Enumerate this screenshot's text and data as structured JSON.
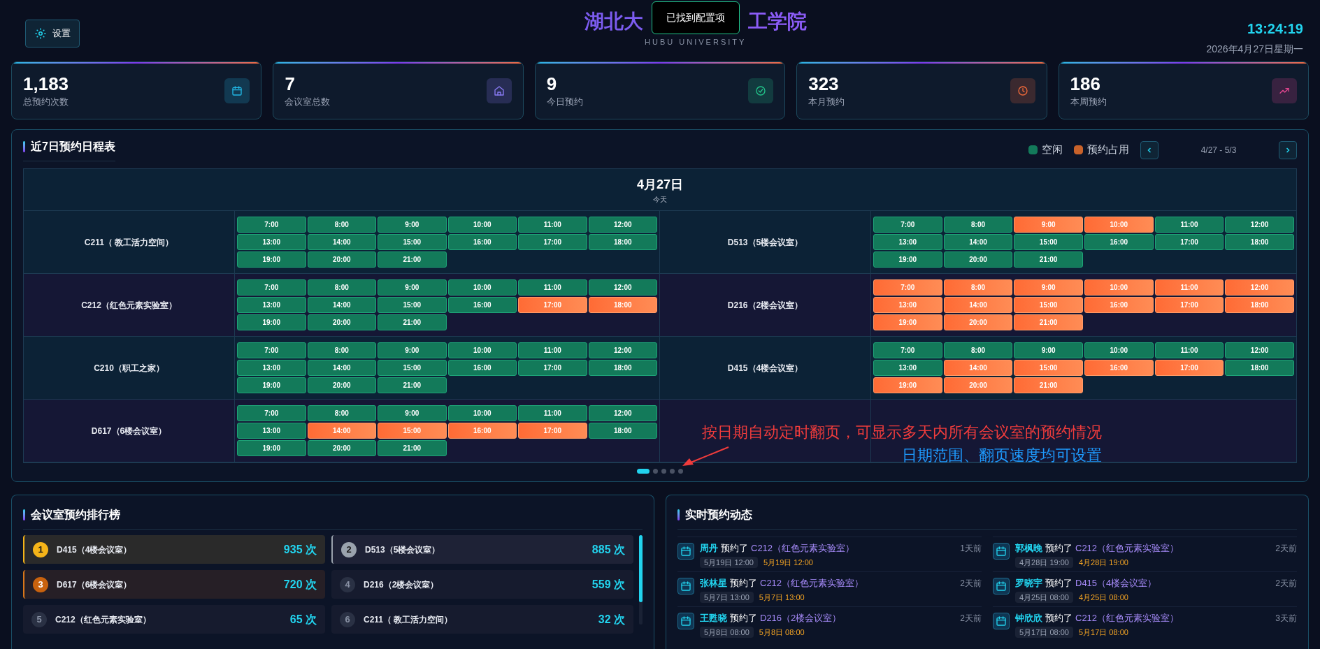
{
  "header": {
    "settings_label": "设置",
    "title_left": "湖北大",
    "title_right": "工学院",
    "toast": "已找到配置项",
    "subtitle": "HUBU UNIVERSITY",
    "time": "13:24:19",
    "date": "2026年4月27日星期一"
  },
  "stats": [
    {
      "value": "1,183",
      "label": "总预约次数",
      "color": "#22b8e6"
    },
    {
      "value": "7",
      "label": "会议室总数",
      "color": "#8b7cf6"
    },
    {
      "value": "9",
      "label": "今日预约",
      "color": "#22c58b"
    },
    {
      "value": "323",
      "label": "本月预约",
      "color": "#f26b3a"
    },
    {
      "value": "186",
      "label": "本周预约",
      "color": "#e2468f"
    }
  ],
  "schedule": {
    "title": "近7日预约日程表",
    "legend": [
      {
        "label": "空闲",
        "color": "#137a5a"
      },
      {
        "label": "预约占用",
        "color": "#c8622a"
      }
    ],
    "range": "4/27 - 5/3",
    "date": "4月27日",
    "date_note": "今天",
    "rooms": [
      {
        "name": "C211（ 教工活力空间）",
        "slots": [
          {
            "time": "7:00",
            "booked": false
          },
          {
            "time": "8:00",
            "booked": false
          },
          {
            "time": "9:00",
            "booked": false
          },
          {
            "time": "10:00",
            "booked": false
          },
          {
            "time": "11:00",
            "booked": false
          },
          {
            "time": "12:00",
            "booked": false
          },
          {
            "time": "13:00",
            "booked": false
          },
          {
            "time": "14:00",
            "booked": false
          },
          {
            "time": "15:00",
            "booked": false
          },
          {
            "time": "16:00",
            "booked": false
          },
          {
            "time": "17:00",
            "booked": false
          },
          {
            "time": "18:00",
            "booked": false
          },
          {
            "time": "19:00",
            "booked": false
          },
          {
            "time": "20:00",
            "booked": false
          },
          {
            "time": "21:00",
            "booked": false
          }
        ]
      },
      {
        "name": "D513（5楼会议室）",
        "slots": [
          {
            "time": "7:00",
            "booked": false
          },
          {
            "time": "8:00",
            "booked": false
          },
          {
            "time": "9:00",
            "booked": true
          },
          {
            "time": "10:00",
            "booked": true
          },
          {
            "time": "11:00",
            "booked": false
          },
          {
            "time": "12:00",
            "booked": false
          },
          {
            "time": "13:00",
            "booked": false
          },
          {
            "time": "14:00",
            "booked": false
          },
          {
            "time": "15:00",
            "booked": false
          },
          {
            "time": "16:00",
            "booked": false
          },
          {
            "time": "17:00",
            "booked": false
          },
          {
            "time": "18:00",
            "booked": false
          },
          {
            "time": "19:00",
            "booked": false
          },
          {
            "time": "20:00",
            "booked": false
          },
          {
            "time": "21:00",
            "booked": false
          }
        ]
      },
      {
        "name": "C212（红色元素实验室）",
        "slots": [
          {
            "time": "7:00",
            "booked": false
          },
          {
            "time": "8:00",
            "booked": false
          },
          {
            "time": "9:00",
            "booked": false
          },
          {
            "time": "10:00",
            "booked": false
          },
          {
            "time": "11:00",
            "booked": false
          },
          {
            "time": "12:00",
            "booked": false
          },
          {
            "time": "13:00",
            "booked": false
          },
          {
            "time": "14:00",
            "booked": false
          },
          {
            "time": "15:00",
            "booked": false
          },
          {
            "time": "16:00",
            "booked": false
          },
          {
            "time": "17:00",
            "booked": true
          },
          {
            "time": "18:00",
            "booked": true
          },
          {
            "time": "19:00",
            "booked": false
          },
          {
            "time": "20:00",
            "booked": false
          },
          {
            "time": "21:00",
            "booked": false
          }
        ]
      },
      {
        "name": "D216（2楼会议室）",
        "slots": [
          {
            "time": "7:00",
            "booked": true
          },
          {
            "time": "8:00",
            "booked": true
          },
          {
            "time": "9:00",
            "booked": true
          },
          {
            "time": "10:00",
            "booked": true
          },
          {
            "time": "11:00",
            "booked": true
          },
          {
            "time": "12:00",
            "booked": true
          },
          {
            "time": "13:00",
            "booked": true
          },
          {
            "time": "14:00",
            "booked": true
          },
          {
            "time": "15:00",
            "booked": true
          },
          {
            "time": "16:00",
            "booked": true
          },
          {
            "time": "17:00",
            "booked": true
          },
          {
            "time": "18:00",
            "booked": true
          },
          {
            "time": "19:00",
            "booked": true
          },
          {
            "time": "20:00",
            "booked": true
          },
          {
            "time": "21:00",
            "booked": true
          }
        ]
      },
      {
        "name": "C210（职工之家）",
        "slots": [
          {
            "time": "7:00",
            "booked": false
          },
          {
            "time": "8:00",
            "booked": false
          },
          {
            "time": "9:00",
            "booked": false
          },
          {
            "time": "10:00",
            "booked": false
          },
          {
            "time": "11:00",
            "booked": false
          },
          {
            "time": "12:00",
            "booked": false
          },
          {
            "time": "13:00",
            "booked": false
          },
          {
            "time": "14:00",
            "booked": false
          },
          {
            "time": "15:00",
            "booked": false
          },
          {
            "time": "16:00",
            "booked": false
          },
          {
            "time": "17:00",
            "booked": false
          },
          {
            "time": "18:00",
            "booked": false
          },
          {
            "time": "19:00",
            "booked": false
          },
          {
            "time": "20:00",
            "booked": false
          },
          {
            "time": "21:00",
            "booked": false
          }
        ]
      },
      {
        "name": "D415（4楼会议室）",
        "slots": [
          {
            "time": "7:00",
            "booked": false
          },
          {
            "time": "8:00",
            "booked": false
          },
          {
            "time": "9:00",
            "booked": false
          },
          {
            "time": "10:00",
            "booked": false
          },
          {
            "time": "11:00",
            "booked": false
          },
          {
            "time": "12:00",
            "booked": false
          },
          {
            "time": "13:00",
            "booked": false
          },
          {
            "time": "14:00",
            "booked": true
          },
          {
            "time": "15:00",
            "booked": true
          },
          {
            "time": "16:00",
            "booked": true
          },
          {
            "time": "17:00",
            "booked": true
          },
          {
            "time": "18:00",
            "booked": false
          },
          {
            "time": "19:00",
            "booked": true
          },
          {
            "time": "20:00",
            "booked": true
          },
          {
            "time": "21:00",
            "booked": true
          }
        ]
      },
      {
        "name": "D617（6楼会议室）",
        "slots": [
          {
            "time": "7:00",
            "booked": false
          },
          {
            "time": "8:00",
            "booked": false
          },
          {
            "time": "9:00",
            "booked": false
          },
          {
            "time": "10:00",
            "booked": false
          },
          {
            "time": "11:00",
            "booked": false
          },
          {
            "time": "12:00",
            "booked": false
          },
          {
            "time": "13:00",
            "booked": false
          },
          {
            "time": "14:00",
            "booked": true
          },
          {
            "time": "15:00",
            "booked": true
          },
          {
            "time": "16:00",
            "booked": true
          },
          {
            "time": "17:00",
            "booked": true
          },
          {
            "time": "18:00",
            "booked": false
          },
          {
            "time": "19:00",
            "booked": false
          },
          {
            "time": "20:00",
            "booked": false
          },
          {
            "time": "21:00",
            "booked": false
          }
        ]
      }
    ],
    "annotation": [
      "按日期自动定时翻页，可显示多天内所有会议室的预约情况",
      "日期范围、翻页速度均可设置"
    ],
    "pages": [
      {
        "selected": true
      },
      {
        "selected": false
      },
      {
        "selected": false
      },
      {
        "selected": false
      },
      {
        "selected": false
      }
    ]
  },
  "ranking": {
    "title": "会议室预约排行榜",
    "items": [
      {
        "rank": "1",
        "kind": "gold",
        "name": "D415（4楼会议室）",
        "count": "935 次"
      },
      {
        "rank": "2",
        "kind": "silver",
        "name": "D513（5楼会议室）",
        "count": "885 次"
      },
      {
        "rank": "3",
        "kind": "bronze",
        "name": "D617（6楼会议室）",
        "count": "720 次"
      },
      {
        "rank": "4",
        "kind": "plain",
        "name": "D216（2楼会议室）",
        "count": "559 次"
      },
      {
        "rank": "5",
        "kind": "plain",
        "name": "C212（红色元素实验室）",
        "count": "65 次"
      },
      {
        "rank": "6",
        "kind": "plain",
        "name": "C211（ 教工活力空间）",
        "count": "32 次"
      }
    ]
  },
  "activity": {
    "title": "实时预约动态",
    "items": [
      {
        "name": "周丹",
        "action": "预约了",
        "room": "C212（红色元素实验室）",
        "ago": "1天前",
        "created": "5月19日 12:00",
        "booked_time": "5月19日 12:00"
      },
      {
        "name": "郭枫晚",
        "action": "预约了",
        "room": "C212（红色元素实验室）",
        "ago": "2天前",
        "created": "4月28日 19:00",
        "booked_time": "4月28日 19:00"
      },
      {
        "name": "张林星",
        "action": "预约了",
        "room": "C212（红色元素实验室）",
        "ago": "2天前",
        "created": "5月7日 13:00",
        "booked_time": "5月7日 13:00"
      },
      {
        "name": "罗晓宇",
        "action": "预约了",
        "room": "D415（4楼会议室）",
        "ago": "2天前",
        "created": "4月25日 08:00",
        "booked_time": "4月25日 08:00"
      },
      {
        "name": "王甦晓",
        "action": "预约了",
        "room": "D216（2楼会议室）",
        "ago": "2天前",
        "created": "5月8日 08:00",
        "booked_time": "5月8日 08:00"
      },
      {
        "name": "钟欣欣",
        "action": "预约了",
        "room": "C212（红色元素实验室）",
        "ago": "3天前",
        "created": "5月17日 08:00",
        "booked_time": "5月17日 08:00"
      }
    ]
  }
}
